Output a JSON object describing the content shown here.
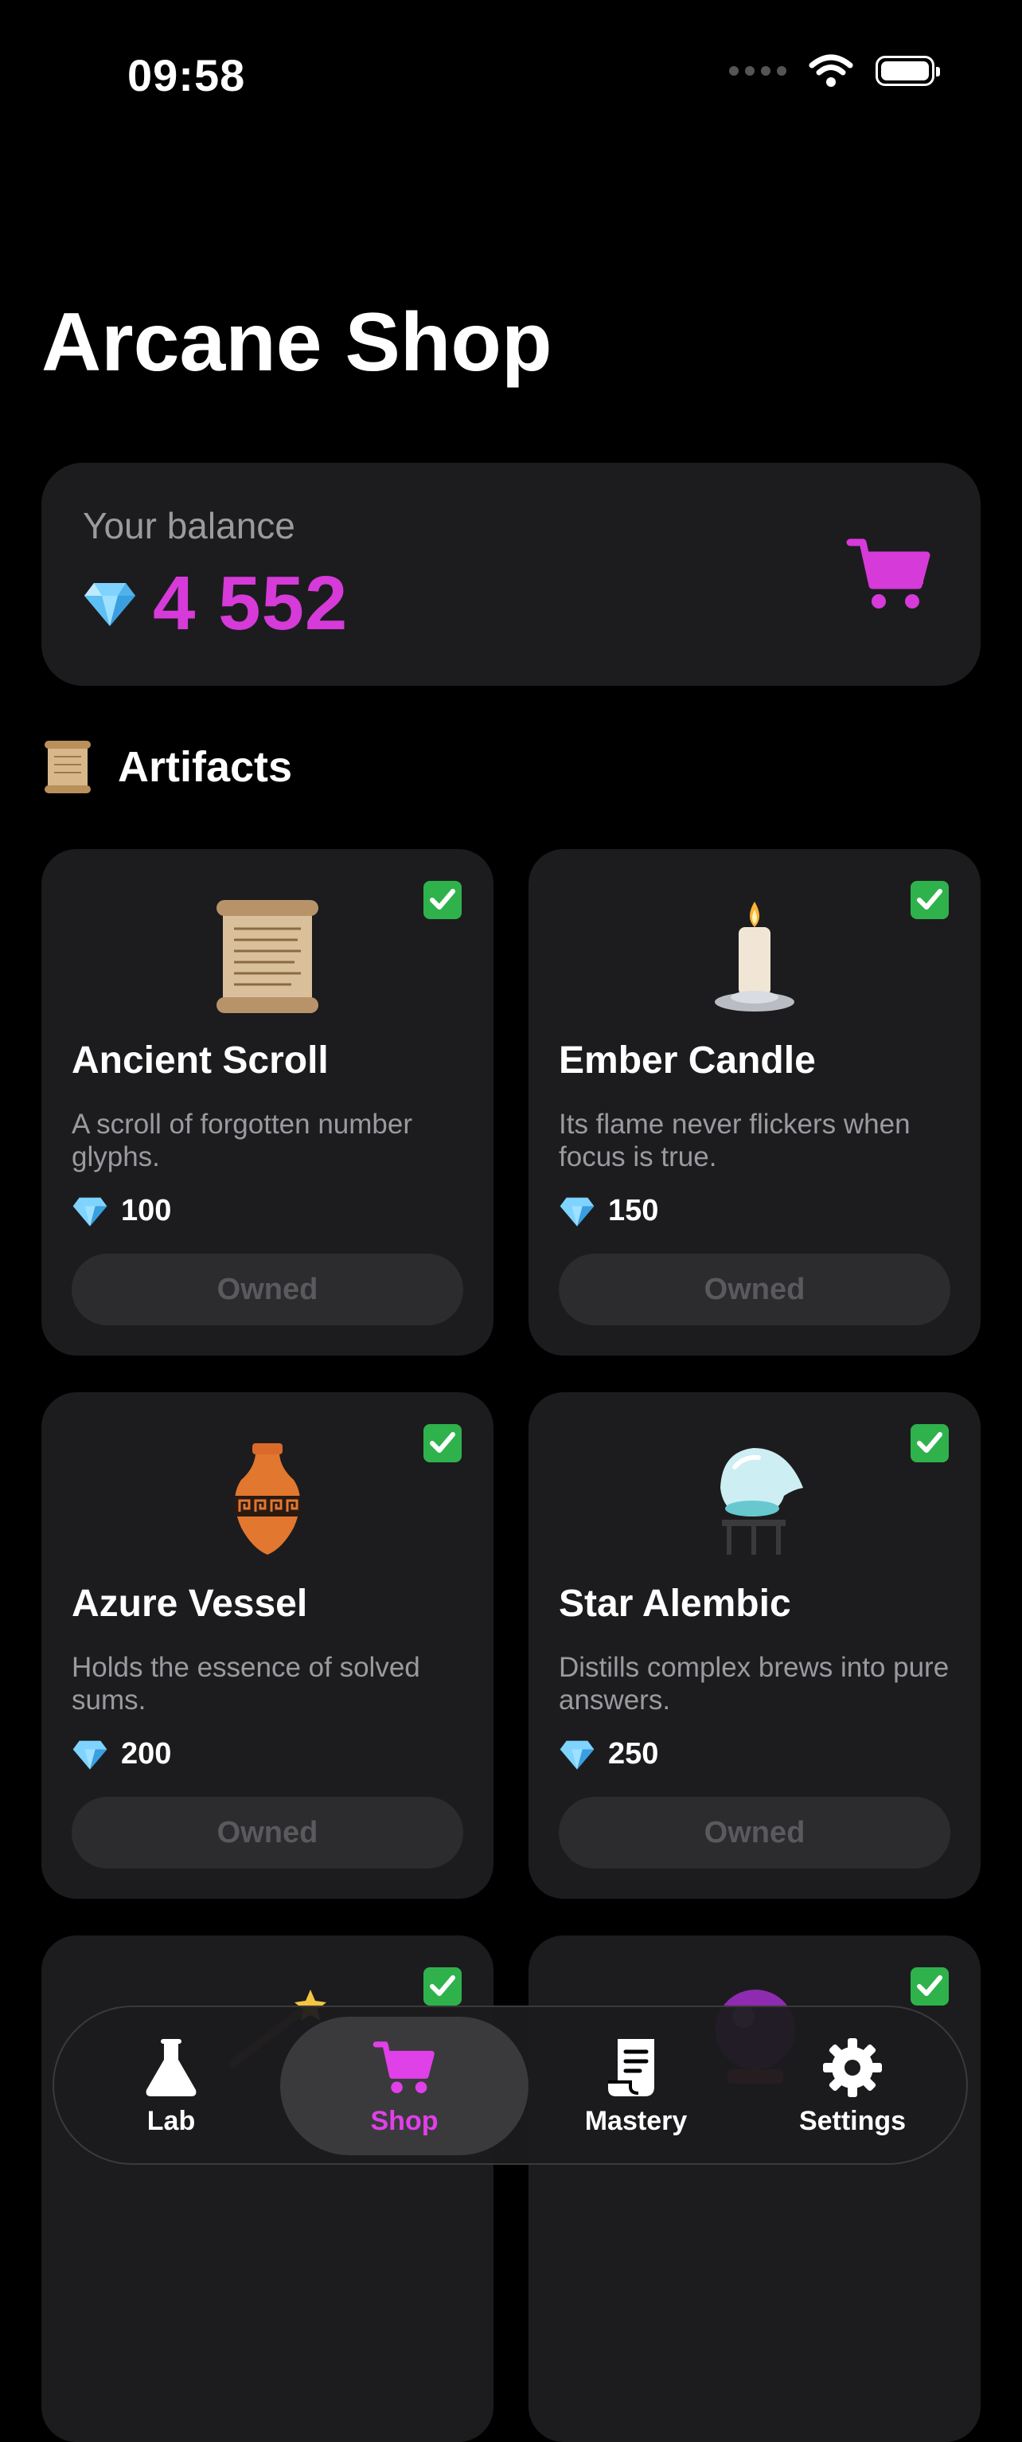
{
  "status_bar": {
    "time": "09:58"
  },
  "page_title": "Arcane Shop",
  "balance": {
    "label": "Your balance",
    "value": "4 552"
  },
  "section": {
    "title": "Artifacts"
  },
  "items": [
    {
      "name": "Ancient Scroll",
      "description": "A scroll of forgotten number glyphs.",
      "price": "100",
      "status": "Owned",
      "art_icon": "scroll-icon"
    },
    {
      "name": "Ember Candle",
      "description": "Its flame never flickers when focus is true.",
      "price": "150",
      "status": "Owned",
      "art_icon": "candle-icon"
    },
    {
      "name": "Azure Vessel",
      "description": "Holds the essence of solved sums.",
      "price": "200",
      "status": "Owned",
      "art_icon": "amphora-icon"
    },
    {
      "name": "Star Alembic",
      "description": "Distills complex brews into pure answers.",
      "price": "250",
      "status": "Owned",
      "art_icon": "alembic-icon"
    }
  ],
  "tabs": [
    {
      "label": "Lab",
      "icon": "flask-icon"
    },
    {
      "label": "Shop",
      "icon": "cart-icon",
      "active": true
    },
    {
      "label": "Mastery",
      "icon": "document-icon"
    },
    {
      "label": "Settings",
      "icon": "gear-icon"
    }
  ],
  "colors": {
    "accent": "#d63ad9",
    "card": "#1c1c1e",
    "check": "#2fb24c",
    "background": "#000000"
  }
}
